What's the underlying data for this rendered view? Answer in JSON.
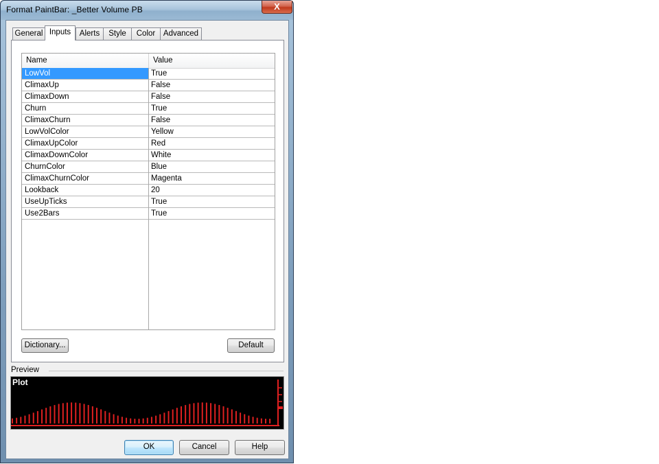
{
  "window": {
    "title": "Format PaintBar: _Better Volume PB",
    "close_glyph": "X"
  },
  "tabs": [
    {
      "label": "General"
    },
    {
      "label": "Inputs"
    },
    {
      "label": "Alerts"
    },
    {
      "label": "Style"
    },
    {
      "label": "Color"
    },
    {
      "label": "Advanced"
    }
  ],
  "grid": {
    "headers": {
      "name": "Name",
      "value": "Value"
    },
    "rows": [
      {
        "name": "LowVol",
        "value": "True"
      },
      {
        "name": "ClimaxUp",
        "value": "False"
      },
      {
        "name": "ClimaxDown",
        "value": "False"
      },
      {
        "name": "Churn",
        "value": "True"
      },
      {
        "name": "ClimaxChurn",
        "value": "False"
      },
      {
        "name": "LowVolColor",
        "value": "Yellow"
      },
      {
        "name": "ClimaxUpColor",
        "value": "Red"
      },
      {
        "name": "ClimaxDownColor",
        "value": "White"
      },
      {
        "name": "ChurnColor",
        "value": "Blue"
      },
      {
        "name": "ClimaxChurnColor",
        "value": "Magenta"
      },
      {
        "name": "Lookback",
        "value": "20"
      },
      {
        "name": "UseUpTicks",
        "value": "True"
      },
      {
        "name": "Use2Bars",
        "value": "True"
      }
    ]
  },
  "buttons": {
    "dictionary": "Dictionary...",
    "default": "Default",
    "ok": "OK",
    "cancel": "Cancel",
    "help": "Help"
  },
  "preview": {
    "label": "Preview",
    "plot_label": "Plot",
    "bar_color": "#e02020",
    "background": "#000000"
  }
}
